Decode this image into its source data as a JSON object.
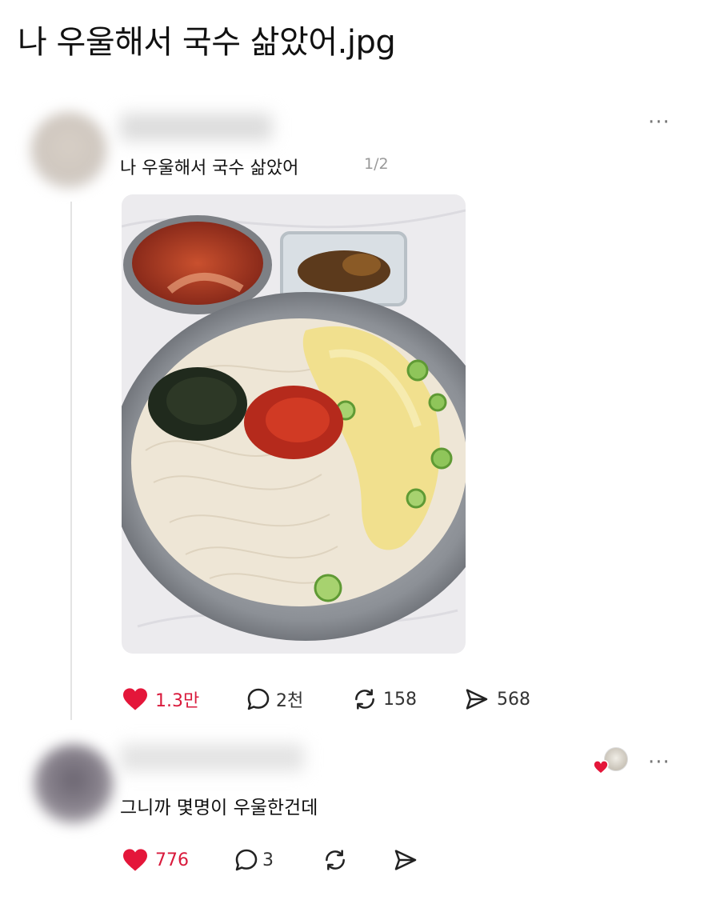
{
  "page": {
    "title": "나 우울해서 국수 삶았어.jpg"
  },
  "post": {
    "text": "나 우울해서 국수 삶았어",
    "image_counter": "1/2",
    "more_label": "···",
    "stats": {
      "likes": "1.3만",
      "comments": "2천",
      "reposts": "158",
      "shares": "568"
    }
  },
  "reply": {
    "text": "그니까 몇명이 우울한건데",
    "more_label": "···",
    "stats": {
      "likes": "776",
      "comments": "3"
    }
  },
  "colors": {
    "like": "#e4163a",
    "text": "#111111",
    "muted": "#999999"
  },
  "icons": [
    "heart-icon",
    "comment-icon",
    "repost-icon",
    "share-icon",
    "more-icon"
  ]
}
